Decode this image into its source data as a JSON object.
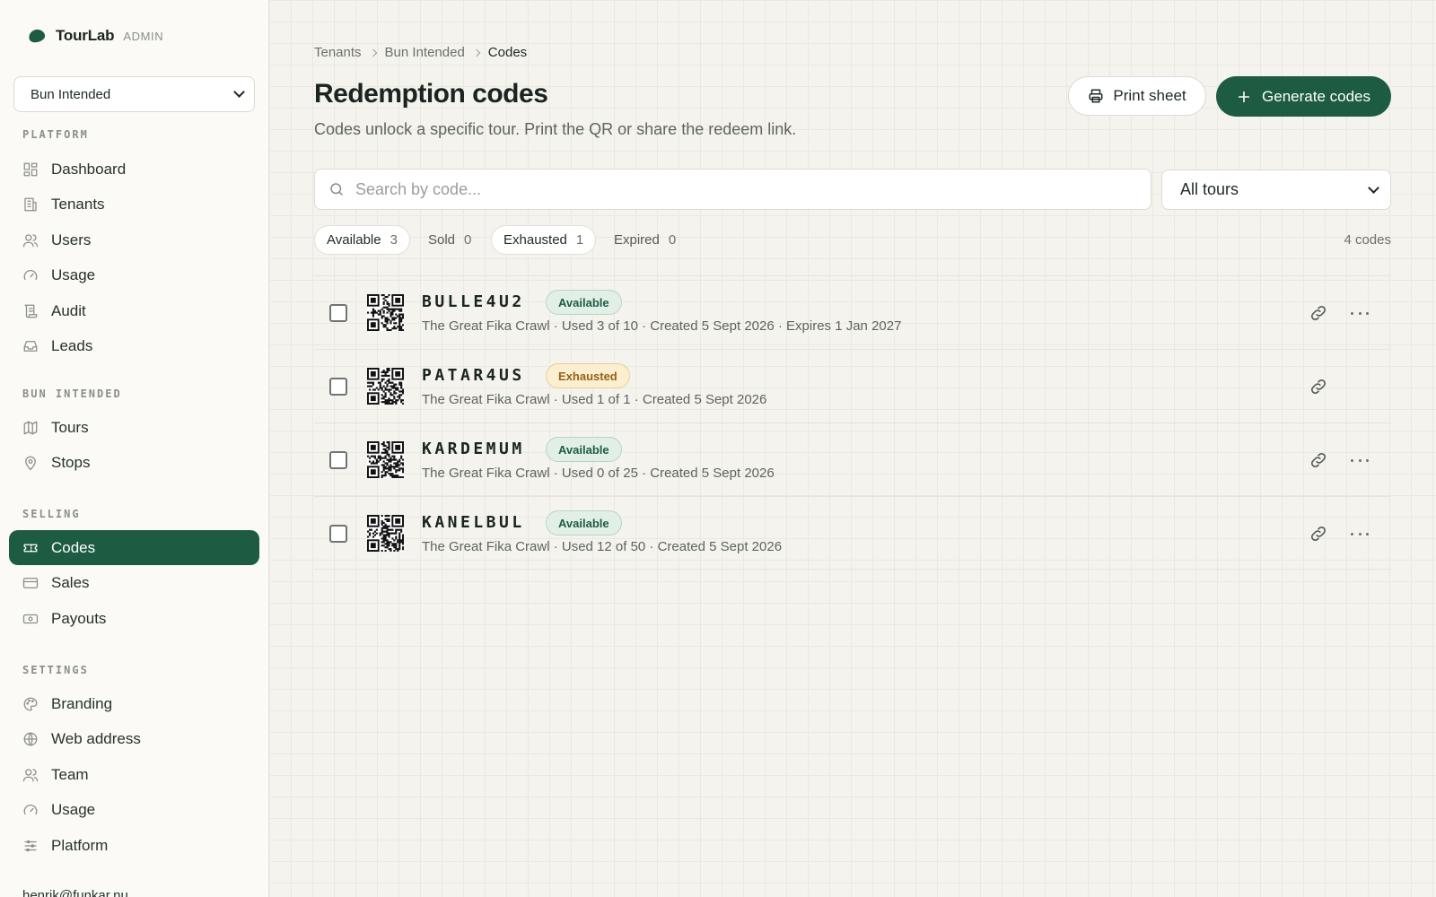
{
  "app": {
    "name": "TourLab",
    "tag": "ADMIN"
  },
  "sidebar": {
    "tenant_select": "Bun Intended",
    "sections": [
      {
        "title": "PLATFORM",
        "items": [
          {
            "label": "Dashboard",
            "icon": "dashboard-icon"
          },
          {
            "label": "Tenants",
            "icon": "building-icon"
          },
          {
            "label": "Users",
            "icon": "users-icon"
          },
          {
            "label": "Usage",
            "icon": "gauge-icon"
          },
          {
            "label": "Audit",
            "icon": "scroll-icon"
          },
          {
            "label": "Leads",
            "icon": "inbox-icon"
          }
        ]
      },
      {
        "title": "BUN INTENDED",
        "items": [
          {
            "label": "Tours",
            "icon": "map-icon"
          },
          {
            "label": "Stops",
            "icon": "map-pin-icon"
          }
        ]
      },
      {
        "title": "SELLING",
        "items": [
          {
            "label": "Codes",
            "icon": "ticket-icon",
            "active": true
          },
          {
            "label": "Sales",
            "icon": "credit-card-icon"
          },
          {
            "label": "Payouts",
            "icon": "banknote-icon"
          }
        ]
      },
      {
        "title": "SETTINGS",
        "items": [
          {
            "label": "Branding",
            "icon": "palette-icon"
          },
          {
            "label": "Web address",
            "icon": "globe-icon"
          },
          {
            "label": "Team",
            "icon": "users-icon"
          },
          {
            "label": "Usage",
            "icon": "gauge-icon"
          },
          {
            "label": "Platform",
            "icon": "sliders-icon"
          }
        ]
      }
    ],
    "user_email": "henrik@funkar.nu"
  },
  "breadcrumb": [
    "Tenants",
    "Bun Intended",
    "Codes"
  ],
  "page": {
    "title": "Redemption codes",
    "subtitle": "Codes unlock a specific tour. Print the QR or share the redeem link."
  },
  "actions": {
    "print": "Print sheet",
    "generate": "Generate codes"
  },
  "search": {
    "placeholder": "Search by code...",
    "value": ""
  },
  "tour_filter": {
    "selected": "All tours"
  },
  "filters": [
    {
      "label": "Available",
      "count": "3",
      "pill": true
    },
    {
      "label": "Sold",
      "count": "0",
      "pill": false
    },
    {
      "label": "Exhausted",
      "count": "1",
      "pill": true
    },
    {
      "label": "Expired",
      "count": "0",
      "pill": false
    }
  ],
  "code_count": "4 codes",
  "codes": [
    {
      "code": "BULLE4U2",
      "status": "Available",
      "status_kind": "available",
      "meta": "The Great Fika Crawl · Used 3 of 10 · Created 5 Sept 2026 · Expires 1 Jan 2027",
      "has_menu": true
    },
    {
      "code": "PATAR4US",
      "status": "Exhausted",
      "status_kind": "exhausted",
      "meta": "The Great Fika Crawl · Used 1 of 1 · Created 5 Sept 2026",
      "has_menu": false
    },
    {
      "code": "KARDEMUM",
      "status": "Available",
      "status_kind": "available",
      "meta": "The Great Fika Crawl · Used 0 of 25 · Created 5 Sept 2026",
      "has_menu": true
    },
    {
      "code": "KANELBUL",
      "status": "Available",
      "status_kind": "available",
      "meta": "The Great Fika Crawl · Used 12 of 50 · Created 5 Sept 2026",
      "has_menu": true
    }
  ],
  "colors": {
    "accent": "#1d5c43",
    "available_bg": "#e2efe6",
    "exhausted_bg": "#fbeed1"
  }
}
